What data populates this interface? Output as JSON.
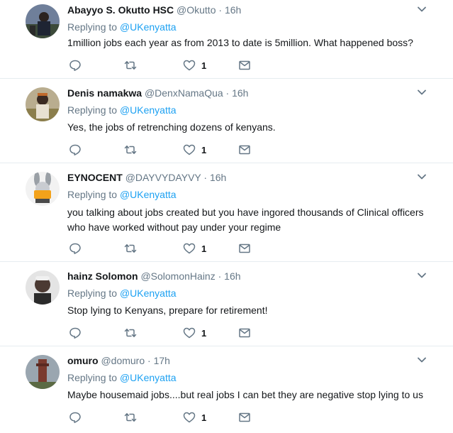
{
  "tweets": [
    {
      "fullname": "Abayyo S. Okutto HSC",
      "username": "@Okutto",
      "separator": "·",
      "time": "16h",
      "replying_label": "Replying to",
      "replying_to": "@UKenyatta",
      "text": "1million jobs each year as from 2013 to date is 5million. What happened boss?",
      "like_count": "1"
    },
    {
      "fullname": "Denis namakwa",
      "username": "@DenxNamaQua",
      "separator": "·",
      "time": "16h",
      "replying_label": "Replying to",
      "replying_to": "@UKenyatta",
      "text": "Yes, the jobs of retrenching dozens of kenyans.",
      "like_count": "1"
    },
    {
      "fullname": "EYNOCENT",
      "username": "@DAYVYDAYVY",
      "separator": "·",
      "time": "16h",
      "replying_label": "Replying to",
      "replying_to": "@UKenyatta",
      "text": "you talking about jobs created but you have ingored thousands of Clinical officers who have worked without pay under your regime",
      "like_count": "1"
    },
    {
      "fullname": "hainz Solomon",
      "username": "@SolomonHainz",
      "separator": "·",
      "time": "16h",
      "replying_label": "Replying to",
      "replying_to": "@UKenyatta",
      "text": "Stop lying to Kenyans, prepare for retirement!",
      "like_count": "1"
    },
    {
      "fullname": "omuro",
      "username": "@domuro",
      "separator": "·",
      "time": "17h",
      "replying_label": "Replying to",
      "replying_to": "@UKenyatta",
      "text": "Maybe housemaid jobs....but real jobs I can bet they are negative stop lying to us",
      "like_count": "1"
    }
  ],
  "icons": {
    "reply": "reply-icon",
    "retweet": "retweet-icon",
    "like": "heart-icon",
    "message": "envelope-icon",
    "more": "chevron-down-icon"
  },
  "colors": {
    "link": "#1da1f2",
    "secondary_text": "#657786",
    "primary_text": "#14171a",
    "divider": "#e6ecf0"
  }
}
